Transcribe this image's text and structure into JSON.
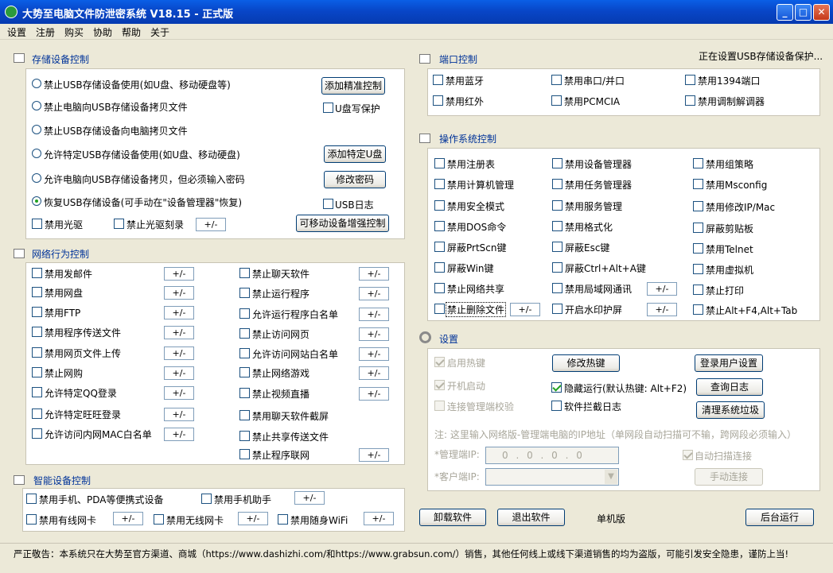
{
  "window": {
    "title": "大势至电脑文件防泄密系统 V18.15 - 正式版",
    "min": "_",
    "max": "□",
    "close": "✕"
  },
  "menu": [
    "设置",
    "注册",
    "购买",
    "协助",
    "帮助",
    "关于"
  ],
  "storage": {
    "title": "存储设备控制",
    "radios": [
      "禁止USB存储设备使用(如U盘、移动硬盘等)",
      "禁止电脑向USB存储设备拷贝文件",
      "禁止USB存储设备向电脑拷贝文件",
      "允许特定USB存储设备使用(如U盘、移动硬盘)",
      "允许电脑向USB存储设备拷贝，但必须输入密码",
      "恢复USB存储设备(可手动在\"设备管理器\"恢复)"
    ],
    "btn_precise": "添加精准控制",
    "cb_uwrite": "U盘写保护",
    "btn_add_u": "添加特定U盘",
    "btn_pwd": "修改密码",
    "cb_usblog": "USB日志",
    "cb_cdrom": "禁用光驱",
    "cb_burn": "禁止光驱刻录",
    "pm": "+/-",
    "btn_mobile": "可移动设备增强控制"
  },
  "network": {
    "title": "网络行为控制",
    "left": [
      "禁用发邮件",
      "禁用网盘",
      "禁用FTP",
      "禁用程序传送文件",
      "禁用网页文件上传",
      "禁止网购",
      "允许特定QQ登录",
      "允许特定旺旺登录",
      "允许访问内网MAC白名单"
    ],
    "right": [
      "禁止聊天软件",
      "禁止运行程序",
      "允许运行程序白名单",
      "禁止访问网页",
      "允许访问网站白名单",
      "禁止网络游戏",
      "禁止视频直播",
      "禁用聊天软件截屏",
      "禁止共享传送文件",
      "禁止程序联网"
    ]
  },
  "smart": {
    "title": "智能设备控制",
    "row1": [
      "禁用手机、PDA等便携式设备",
      "禁用手机助手"
    ],
    "row2": [
      "禁用有线网卡",
      "禁用无线网卡",
      "禁用随身WiFi"
    ]
  },
  "port": {
    "title": "端口控制",
    "status": "正在设置USB存储设备保护...",
    "items": [
      "禁用蓝牙",
      "禁用串口/并口",
      "禁用1394端口",
      "禁用红外",
      "禁用PCMCIA",
      "禁用调制解调器"
    ]
  },
  "os": {
    "title": "操作系统控制",
    "col1": [
      "禁用注册表",
      "禁用计算机管理",
      "禁用安全模式",
      "禁用DOS命令",
      "屏蔽PrtScn键",
      "屏蔽Win键",
      "禁止网络共享",
      "禁止删除文件"
    ],
    "col2": [
      "禁用设备管理器",
      "禁用任务管理器",
      "禁用服务管理",
      "禁用格式化",
      "屏蔽Esc键",
      "屏蔽Ctrl+Alt+A键",
      "禁用局域网通讯",
      "开启水印护屏"
    ],
    "col3": [
      "禁用组策略",
      "禁用Msconfig",
      "禁用修改IP/Mac",
      "屏蔽剪贴板",
      "禁用Telnet",
      "禁用虚拟机",
      "禁止打印",
      "禁止Alt+F4,Alt+Tab"
    ]
  },
  "settings": {
    "title": "设置",
    "hotkey": "启用热键",
    "autostart": "开机启动",
    "connect": "连接管理端校验",
    "hidden": "隐藏运行(默认热键: Alt+F2)",
    "intercept": "软件拦截日志",
    "btn_hotkey": "修改热键",
    "btn_login": "登录用户设置",
    "btn_log": "查询日志",
    "btn_clean": "清理系统垃圾",
    "note": "注: 这里输入网络版-管理端电脑的IP地址（单网段自动扫描可不输，跨网段必须输入）",
    "mgr_label": "*管理端IP:",
    "mgr_ip": "0 . 0 . 0 . 0",
    "cli_label": "*客户端IP:",
    "autoscan": "自动扫描连接",
    "btn_manual": "手动连接"
  },
  "bottom": {
    "uninstall": "卸载软件",
    "exit": "退出软件",
    "edition": "单机版",
    "bg": "后台运行"
  },
  "footer": "严正敬告：本系统只在大势至官方渠道、商城（https://www.dashizhi.com/和https://www.grabsun.com/）销售，其他任何线上或线下渠道销售的均为盗版，可能引发安全隐患，谨防上当!",
  "colors": {
    "title_bar": "#0846c8",
    "section_title": "#003399",
    "check": "#21a121"
  }
}
